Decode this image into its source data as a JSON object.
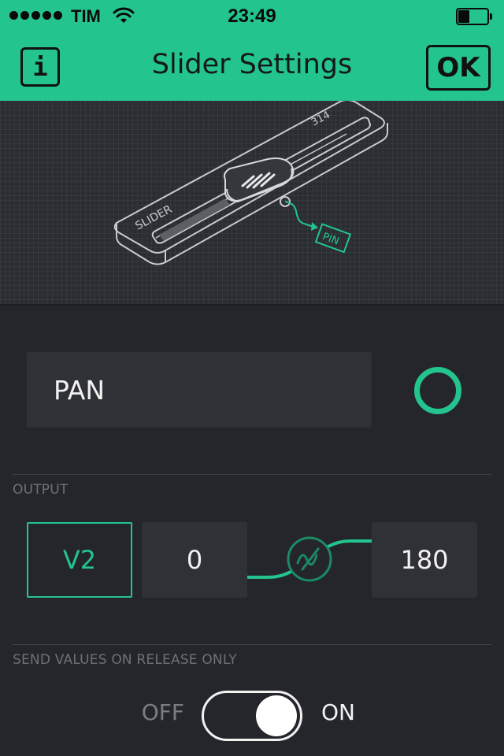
{
  "status_bar": {
    "carrier": "TIM",
    "time": "23:49",
    "signal_bars": 5,
    "battery_level": 0.4
  },
  "header": {
    "title": "Slider Settings",
    "info_label": "i",
    "ok_label": "OK"
  },
  "illustration": {
    "widget_label": "SLIDER",
    "value_label": "314",
    "pin_label": "PIN"
  },
  "name_field": {
    "value": "PAN",
    "color": "#23c48e"
  },
  "output": {
    "section_label": "OUTPUT",
    "pin": "V2",
    "min": "0",
    "max": "180"
  },
  "send_on_release": {
    "section_label": "SEND VALUES ON RELEASE ONLY",
    "off_label": "OFF",
    "on_label": "ON",
    "value": true
  },
  "colors": {
    "accent": "#23c48e",
    "background": "#24262b",
    "field": "#2f3136"
  },
  "icons": {
    "info": "info-icon",
    "wifi": "wifi-icon",
    "battery": "battery-icon",
    "mapping": "wave-icon"
  }
}
